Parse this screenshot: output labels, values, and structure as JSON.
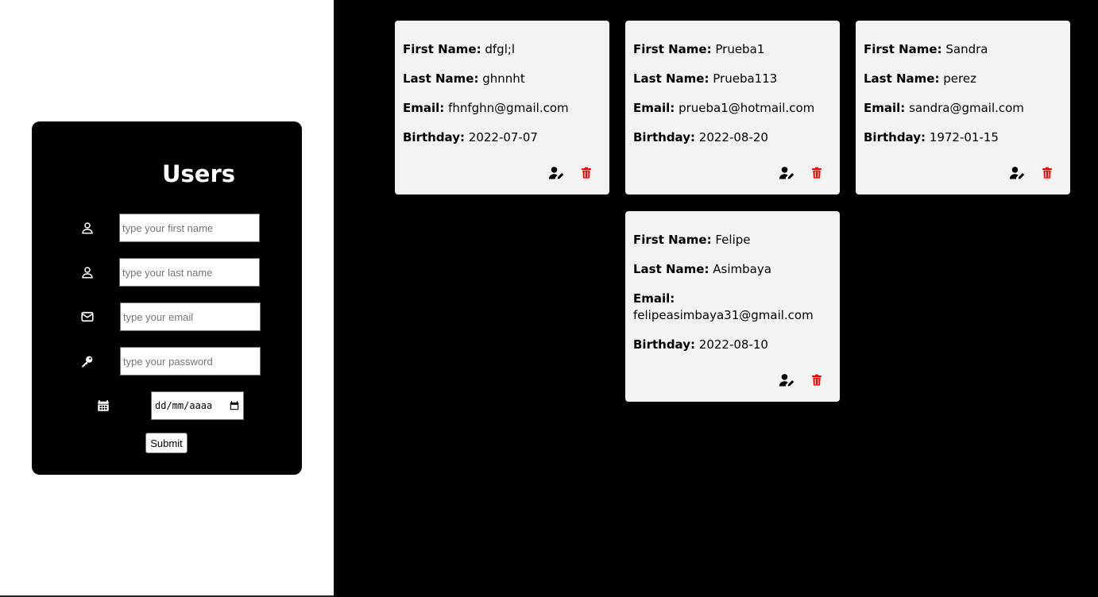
{
  "form": {
    "title": "Users",
    "first_name_placeholder": "type your first name",
    "last_name_placeholder": "type your last name",
    "email_placeholder": "type your email",
    "password_placeholder": "type your password",
    "date_placeholder": "dd/mm/aaaa",
    "submit_label": "Submit"
  },
  "labels": {
    "first_name": "First Name:",
    "last_name": "Last Name:",
    "email": "Email:",
    "birthday": "Birthday:"
  },
  "users": [
    {
      "first_name": "dfgl;l",
      "last_name": "ghnnht",
      "email": "fhnfghn@gmail.com",
      "birthday": "2022-07-07"
    },
    {
      "first_name": "Prueba1",
      "last_name": "Prueba113",
      "email": "prueba1@hotmail.com",
      "birthday": "2022-08-20"
    },
    {
      "first_name": "Sandra",
      "last_name": "perez",
      "email": "sandra@gmail.com",
      "birthday": "1972-01-15"
    },
    {
      "first_name": "Felipe",
      "last_name": "Asimbaya",
      "email": "felipeasimbaya31@gmail.com",
      "birthday": "2022-08-10"
    }
  ],
  "colors": {
    "delete_icon": "#ff0000",
    "edit_icon": "#000000",
    "card_background": "#f3f3f3",
    "panel_background": "#000000"
  },
  "icons": {
    "first_name": "user-icon",
    "last_name": "user-icon",
    "email": "envelope-icon",
    "password": "key-icon",
    "birthday": "calendar-icon",
    "edit": "user-edit-icon",
    "delete": "trash-icon"
  }
}
